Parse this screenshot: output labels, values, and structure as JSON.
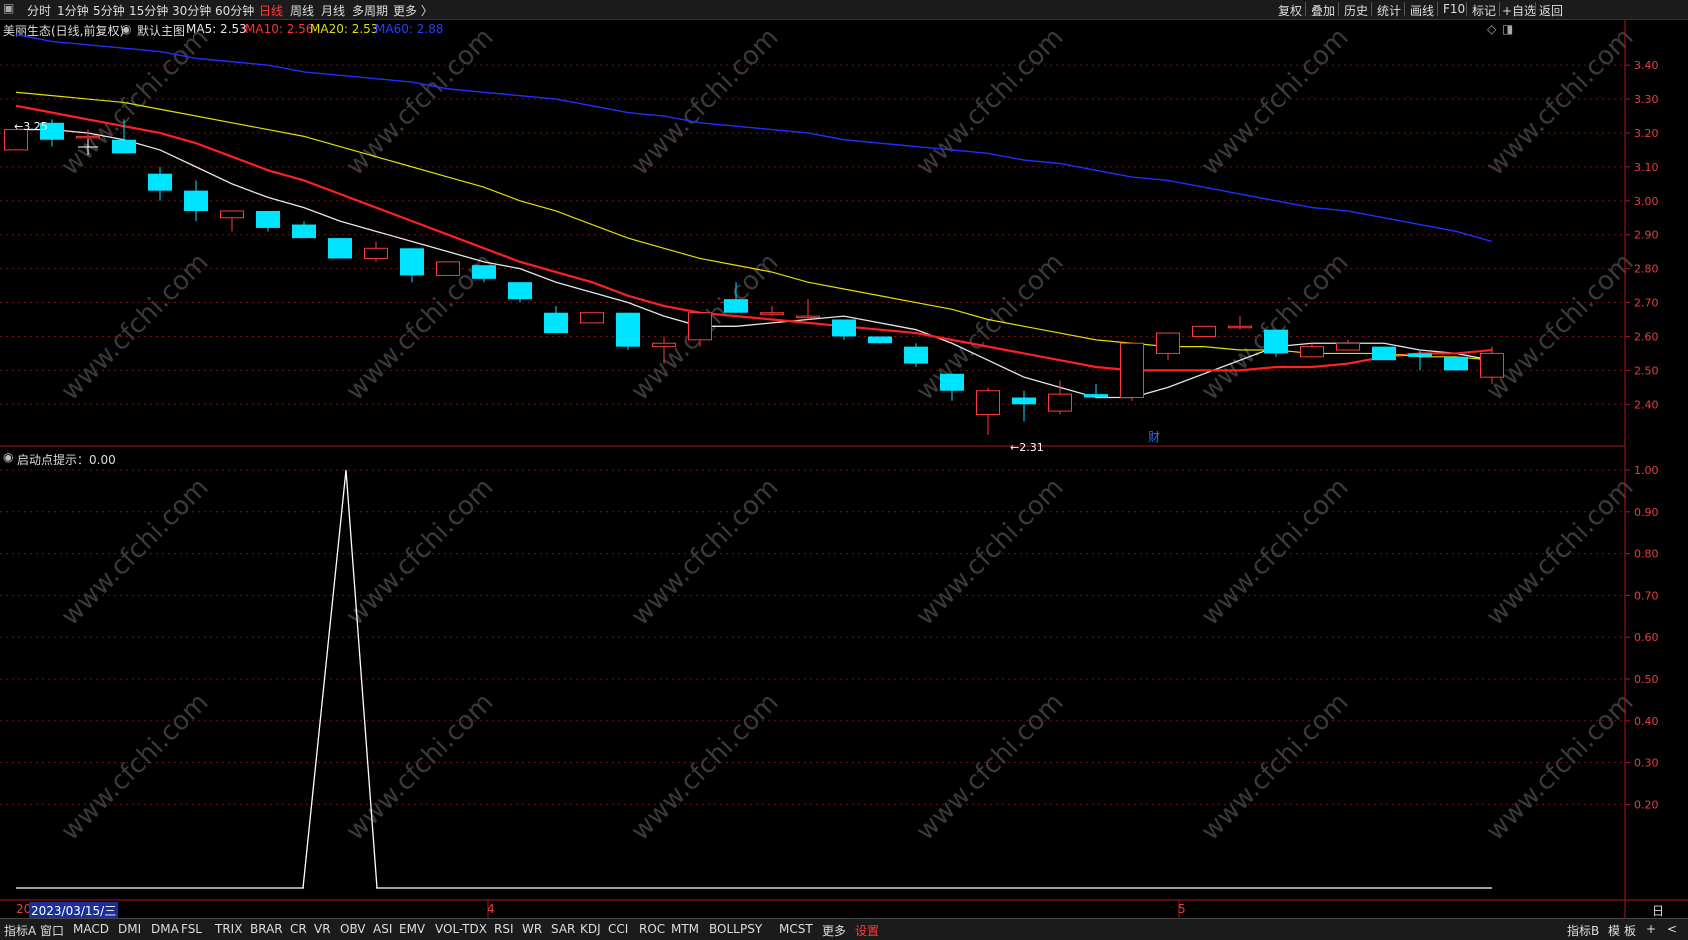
{
  "topbar": {
    "periods": [
      "分时",
      "1分钟",
      "5分钟",
      "15分钟",
      "30分钟",
      "60分钟",
      "日线",
      "周线",
      "月线",
      "多周期",
      "更多 〉"
    ],
    "active_period": "日线",
    "right_items": [
      "复权",
      "叠加",
      "历史",
      "统计",
      "画线",
      "F10",
      "+自选",
      "标记",
      "返回"
    ]
  },
  "main_header": {
    "stock": "美丽生态",
    "mode": "(日线,前复权)",
    "template": "默认主图",
    "ma5_label": "MA5: 2.53",
    "ma10_label": "MA10: 2.56",
    "ma20_label": "MA20: 2.53",
    "ma60_label": "MA60: 2.88"
  },
  "indicator_header": {
    "label": "启动点提示：0.00"
  },
  "annotations": {
    "high": "3.25",
    "low": "2.31",
    "finance_marker": "财"
  },
  "price_axis": [
    "3.40",
    "3.30",
    "3.20",
    "3.10",
    "3.00",
    "2.90",
    "2.80",
    "2.70",
    "2.60",
    "2.50",
    "2.40"
  ],
  "indicator_axis": [
    "1.00",
    "0.90",
    "0.80",
    "0.70",
    "0.60",
    "0.50",
    "0.40",
    "0.30",
    "0.20"
  ],
  "date_axis": {
    "cursor_date": "2023/03/15/三",
    "start_label": "20",
    "month_labels": [
      "4",
      "5"
    ],
    "period_label": "日线"
  },
  "bottombar": {
    "left_label": "指标A",
    "window_label": "窗口",
    "tabs": [
      "MACD",
      "DMI",
      "DMA",
      "FSL",
      "TRIX",
      "BRAR",
      "CR",
      "VR",
      "OBV",
      "ASI",
      "EMV",
      "VOL-TDX",
      "RSI",
      "WR",
      "SAR",
      "KDJ",
      "CCI",
      "ROC",
      "MTM",
      "BOLL",
      "PSY",
      "MCST",
      "更多",
      "设置"
    ],
    "right_items": [
      "指标B",
      "模",
      "板",
      "+",
      "<"
    ]
  },
  "watermark": "www.cfchi.com",
  "colors": {
    "up": "#ff3b3b",
    "down": "#00e5ff",
    "ma5": "#e6e6e6",
    "ma10": "#ff2020",
    "ma20": "#e0e000",
    "ma60": "#2030ff",
    "grid": "#7a1010",
    "indicator": "#ffffff"
  },
  "chart_data": {
    "type": "candlestick",
    "title": "美丽生态 (日线,前复权)",
    "ylim": [
      2.28,
      3.48
    ],
    "candles": [
      {
        "o": 3.15,
        "h": 3.21,
        "l": 3.15,
        "c": 3.21
      },
      {
        "o": 3.23,
        "h": 3.24,
        "l": 3.16,
        "c": 3.18
      },
      {
        "o": 3.19,
        "h": 3.21,
        "l": 3.17,
        "c": 3.19
      },
      {
        "o": 3.18,
        "h": 3.24,
        "l": 3.14,
        "c": 3.14
      },
      {
        "o": 3.08,
        "h": 3.1,
        "l": 3.0,
        "c": 3.03
      },
      {
        "o": 3.03,
        "h": 3.06,
        "l": 2.94,
        "c": 2.97
      },
      {
        "o": 2.95,
        "h": 2.97,
        "l": 2.91,
        "c": 2.97
      },
      {
        "o": 2.97,
        "h": 2.97,
        "l": 2.91,
        "c": 2.92
      },
      {
        "o": 2.93,
        "h": 2.94,
        "l": 2.89,
        "c": 2.89
      },
      {
        "o": 2.89,
        "h": 2.89,
        "l": 2.83,
        "c": 2.83
      },
      {
        "o": 2.83,
        "h": 2.88,
        "l": 2.82,
        "c": 2.86
      },
      {
        "o": 2.86,
        "h": 2.86,
        "l": 2.76,
        "c": 2.78
      },
      {
        "o": 2.78,
        "h": 2.82,
        "l": 2.78,
        "c": 2.82
      },
      {
        "o": 2.81,
        "h": 2.81,
        "l": 2.76,
        "c": 2.77
      },
      {
        "o": 2.76,
        "h": 2.76,
        "l": 2.7,
        "c": 2.71
      },
      {
        "o": 2.67,
        "h": 2.69,
        "l": 2.61,
        "c": 2.61
      },
      {
        "o": 2.64,
        "h": 2.67,
        "l": 2.64,
        "c": 2.67
      },
      {
        "o": 2.67,
        "h": 2.67,
        "l": 2.56,
        "c": 2.57
      },
      {
        "o": 2.57,
        "h": 2.6,
        "l": 2.52,
        "c": 2.58
      },
      {
        "o": 2.59,
        "h": 2.67,
        "l": 2.57,
        "c": 2.67
      },
      {
        "o": 2.71,
        "h": 2.76,
        "l": 2.67,
        "c": 2.67
      },
      {
        "o": 2.67,
        "h": 2.69,
        "l": 2.66,
        "c": 2.67
      },
      {
        "o": 2.66,
        "h": 2.71,
        "l": 2.65,
        "c": 2.66
      },
      {
        "o": 2.65,
        "h": 2.65,
        "l": 2.59,
        "c": 2.6
      },
      {
        "o": 2.6,
        "h": 2.6,
        "l": 2.58,
        "c": 2.58
      },
      {
        "o": 2.57,
        "h": 2.58,
        "l": 2.51,
        "c": 2.52
      },
      {
        "o": 2.49,
        "h": 2.49,
        "l": 2.41,
        "c": 2.44
      },
      {
        "o": 2.37,
        "h": 2.45,
        "l": 2.31,
        "c": 2.44
      },
      {
        "o": 2.42,
        "h": 2.44,
        "l": 2.35,
        "c": 2.4
      },
      {
        "o": 2.38,
        "h": 2.47,
        "l": 2.37,
        "c": 2.43
      },
      {
        "o": 2.43,
        "h": 2.46,
        "l": 2.42,
        "c": 2.42
      },
      {
        "o": 2.42,
        "h": 2.58,
        "l": 2.41,
        "c": 2.58
      },
      {
        "o": 2.55,
        "h": 2.61,
        "l": 2.53,
        "c": 2.61
      },
      {
        "o": 2.6,
        "h": 2.63,
        "l": 2.6,
        "c": 2.63
      },
      {
        "o": 2.63,
        "h": 2.66,
        "l": 2.62,
        "c": 2.63
      },
      {
        "o": 2.62,
        "h": 2.62,
        "l": 2.54,
        "c": 2.55
      },
      {
        "o": 2.54,
        "h": 2.58,
        "l": 2.54,
        "c": 2.57
      },
      {
        "o": 2.56,
        "h": 2.59,
        "l": 2.56,
        "c": 2.58
      },
      {
        "o": 2.57,
        "h": 2.57,
        "l": 2.53,
        "c": 2.53
      },
      {
        "o": 2.55,
        "h": 2.56,
        "l": 2.5,
        "c": 2.54
      },
      {
        "o": 2.54,
        "h": 2.54,
        "l": 2.5,
        "c": 2.5
      },
      {
        "o": 2.48,
        "h": 2.57,
        "l": 2.46,
        "c": 2.55
      }
    ],
    "ma_series": [
      {
        "name": "MA5",
        "values": [
          3.21,
          3.21,
          3.2,
          3.18,
          3.15,
          3.1,
          3.05,
          3.01,
          2.98,
          2.94,
          2.91,
          2.88,
          2.85,
          2.82,
          2.8,
          2.76,
          2.73,
          2.7,
          2.66,
          2.63,
          2.63,
          2.64,
          2.65,
          2.66,
          2.64,
          2.62,
          2.58,
          2.53,
          2.48,
          2.45,
          2.42,
          2.42,
          2.45,
          2.49,
          2.53,
          2.57,
          2.58,
          2.58,
          2.58,
          2.56,
          2.55,
          2.53
        ]
      },
      {
        "name": "MA10",
        "values": [
          3.28,
          3.26,
          3.24,
          3.22,
          3.2,
          3.17,
          3.13,
          3.09,
          3.06,
          3.02,
          2.98,
          2.94,
          2.9,
          2.86,
          2.82,
          2.79,
          2.76,
          2.72,
          2.69,
          2.67,
          2.66,
          2.65,
          2.64,
          2.63,
          2.62,
          2.61,
          2.59,
          2.57,
          2.55,
          2.53,
          2.51,
          2.5,
          2.5,
          2.5,
          2.5,
          2.51,
          2.51,
          2.52,
          2.54,
          2.55,
          2.55,
          2.56
        ]
      },
      {
        "name": "MA20",
        "values": [
          3.32,
          3.31,
          3.3,
          3.29,
          3.27,
          3.25,
          3.23,
          3.21,
          3.19,
          3.16,
          3.13,
          3.1,
          3.07,
          3.04,
          3.0,
          2.97,
          2.93,
          2.89,
          2.86,
          2.83,
          2.81,
          2.79,
          2.76,
          2.74,
          2.72,
          2.7,
          2.68,
          2.65,
          2.63,
          2.61,
          2.59,
          2.58,
          2.57,
          2.57,
          2.56,
          2.56,
          2.55,
          2.55,
          2.55,
          2.54,
          2.54,
          2.53
        ]
      },
      {
        "name": "MA60",
        "values": [
          3.49,
          3.47,
          3.46,
          3.45,
          3.44,
          3.42,
          3.41,
          3.4,
          3.38,
          3.37,
          3.36,
          3.35,
          3.33,
          3.32,
          3.31,
          3.3,
          3.28,
          3.26,
          3.25,
          3.23,
          3.22,
          3.21,
          3.2,
          3.18,
          3.17,
          3.16,
          3.15,
          3.14,
          3.12,
          3.11,
          3.09,
          3.07,
          3.06,
          3.04,
          3.02,
          3.0,
          2.98,
          2.97,
          2.95,
          2.93,
          2.91,
          2.88
        ]
      }
    ],
    "indicator": {
      "name": "启动点提示",
      "ylim": [
        0,
        1
      ],
      "values": [
        0,
        0,
        0,
        0,
        0,
        0,
        0,
        0,
        0,
        1,
        0,
        0,
        0,
        0,
        0,
        0,
        0,
        0,
        0,
        0,
        0,
        0,
        0,
        0,
        0,
        0,
        0,
        0,
        0,
        0,
        0,
        0,
        0,
        0,
        0,
        0,
        0,
        0,
        0,
        0,
        0,
        0
      ]
    }
  }
}
